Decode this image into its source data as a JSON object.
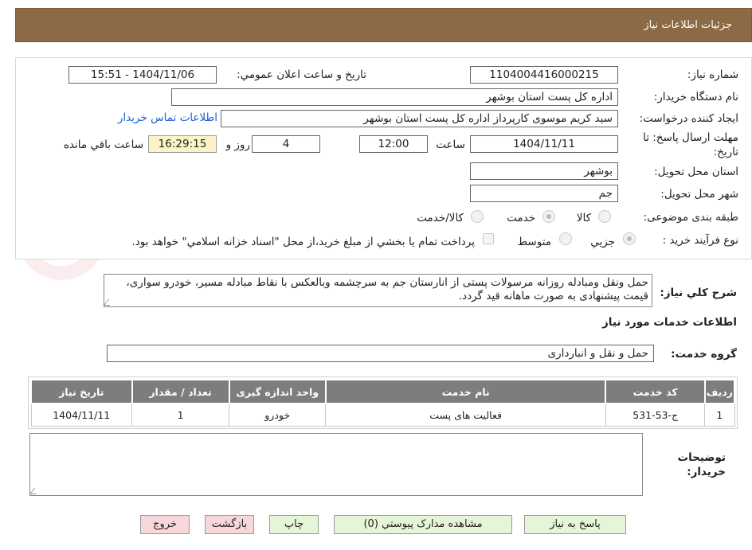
{
  "header": {
    "title": "جزئیات اطلاعات نیاز"
  },
  "form": {
    "need_number_label": "شماره نیاز:",
    "need_number": "1104004416000215",
    "announce_label": "تاریخ و ساعت اعلان عمومي:",
    "announce_value": "1404/11/06 - 15:51",
    "buyer_org_label": "نام دستگاه خريدار:",
    "buyer_org": "اداره کل پست استان بوشهر",
    "requester_label": "ايجاد کننده درخواست:",
    "requester": "سید کریم موسوی کارپرداز اداره کل پست استان بوشهر",
    "contact_link": "اطلاعات تماس خريدار",
    "deadline_label_1": "مهلت ارسال پاسخ: تا",
    "deadline_label_2": "تاریخ:",
    "deadline_date": "1404/11/11",
    "time_label": "ساعت",
    "deadline_time": "12:00",
    "days_value": "4",
    "days_label": "روز و",
    "remaining_time": "16:29:15",
    "remaining_label": "ساعت باقي مانده",
    "province_label": "استان محل تحويل:",
    "province": "بوشهر",
    "city_label": "شهر محل تحويل:",
    "city": "جم",
    "category_label": "طبقه بندی موضوعی:",
    "category_options": [
      "کالا",
      "خدمت",
      "کالا/خدمت"
    ],
    "process_label": "نوع فرآيند خريد :",
    "process_options": [
      "جزيي",
      "متوسط"
    ],
    "payment_note": "پرداخت تمام يا بخشي از مبلغ خريد،از محل \"اسناد خزانه اسلامي\" خواهد بود.",
    "description_label": "شرح کلي نياز:",
    "description": "حمل  ونقل ومبادله روزانه مرسولات پستی از   انارستان  جم به سرچشمه  وبالعکس با نقاط مبادله مسیر، خودرو سواری، قیمت پیشنهادی به صورت ماهانه قید گردد.",
    "services_title": "اطلاعات خدمات مورد نياز",
    "service_group_label": "گروه خدمت:",
    "service_group": "حمل و نقل و انبارداری",
    "buyer_notes_label_1": "توضيحات",
    "buyer_notes_label_2": "خريدار:"
  },
  "table": {
    "headers": [
      "رديف",
      "کد خدمت",
      "نام خدمت",
      "واحد اندازه گيری",
      "تعداد / مقدار",
      "تاريخ نياز"
    ],
    "rows": [
      [
        "1",
        "ج-53-531",
        "فعالیت های پست",
        "خودرو",
        "1",
        "1404/11/11"
      ]
    ]
  },
  "buttons": {
    "respond": "پاسخ به نياز",
    "attachments": "مشاهده مدارک پيوستي (0)",
    "print": "چاپ",
    "back": "بازگشت",
    "exit": "خروج"
  },
  "colors": {
    "header_bg": "#8c6a45",
    "link": "#1a5fd6",
    "table_header_bg": "#7d7d7d",
    "green_button": "#e6f5d8",
    "pink_button": "#f8d7da",
    "remaining_bg": "#fbf4c8"
  }
}
